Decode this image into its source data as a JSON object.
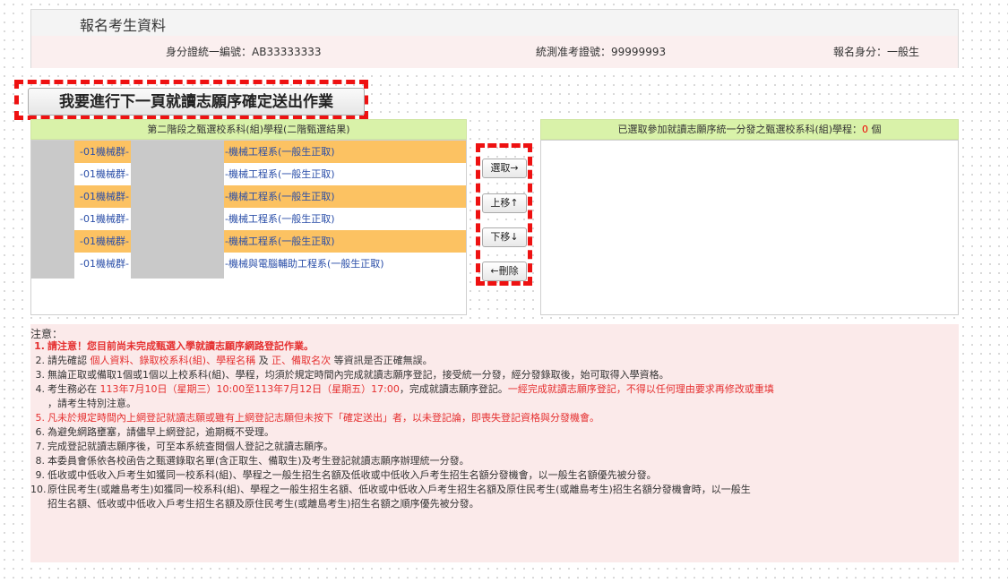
{
  "header": {
    "title": "報名考生資料",
    "id_label": "身分證統一編號：",
    "id_value": "AB33333333",
    "exam_label": "統測准考證號：",
    "exam_value": "99999993",
    "status_label": "報名身分：",
    "status_value": "一般生"
  },
  "next_button": "我要進行下一頁就讀志願序確定送出作業",
  "left_panel": {
    "heading": "第二階段之甄選校系科(組)學程(二階甄選結果)",
    "rows": [
      {
        "code": "-01機械群-",
        "dept": "-機械工程系(一般生正取)"
      },
      {
        "code": "-01機械群-",
        "dept": "-機械工程系(一般生正取)"
      },
      {
        "code": "-01機械群-",
        "dept": "-機械工程系(一般生正取)"
      },
      {
        "code": "-01機械群-",
        "dept": "-機械工程系(一般生正取)"
      },
      {
        "code": "-01機械群-",
        "dept": "-機械工程系(一般生正取)"
      },
      {
        "code": "-01機械群-",
        "dept": "-機械與電腦輔助工程系(一般生正取)"
      }
    ]
  },
  "controls": {
    "select": "選取→",
    "up": "上移↑",
    "down": "下移↓",
    "delete": "←刪除"
  },
  "right_panel": {
    "heading": "已選取參加就讀志願序統一分發之甄選校系科(組)學程：",
    "count": "0",
    "unit": " 個"
  },
  "notes": {
    "heading": "注意：",
    "n1": "請注意！您目前尚未完成甄選入學就讀志願序網路登記作業。",
    "n2a": "請先確認 ",
    "n2b": "個人資料、錄取校系科(組)、學程名稱",
    "n2c": " 及 ",
    "n2d": "正、備取名次",
    "n2e": " 等資訊是否正確無誤。",
    "n3": "無論正取或備取1個或1個以上校系科(組)、學程，均須於規定時間內完成就讀志願序登記，接受統一分發，經分發錄取後，始可取得入學資格。",
    "n4a": "考生務必在 ",
    "n4b": "113年7月10日（星期三）10:00至113年7月12日（星期五）17:00",
    "n4c": "，完成就讀志願序登記。",
    "n4d": "一經完成就讀志願序登記，不得以任何理由要求再修改或重填",
    "n4e": "，請考生特別注意。",
    "n5": "凡未於規定時間內上網登記就讀志願或雖有上網登記志願但未按下「確定送出」者，以未登記論，即喪失登記資格與分發機會。",
    "n6": "為避免網路壅塞，請儘早上網登記，逾期概不受理。",
    "n7": "完成登記就讀志願序後，可至本系統查閱個人登記之就讀志願序。",
    "n8": "本委員會係依各校函告之甄選錄取名單(含正取生、備取生)及考生登記就讀志願序辦理統一分發。",
    "n9": "低收或中低收入戶考生如獲同一校系科(組)、學程之一般生招生名額及低收或中低收入戶考生招生名額分發機會，以一般生名額優先被分發。",
    "n10a": "原住民考生(或離島考生)如獲同一校系科(組)、學程之一般生招生名額、低收或中低收入戶考生招生名額及原住民考生(或離島考生)招生名額分發機會時，以一般生",
    "n10b": "招生名額、低收或中低收入戶考生招生名額及原住民考生(或離島考生)招生名額之順序優先被分發。"
  }
}
